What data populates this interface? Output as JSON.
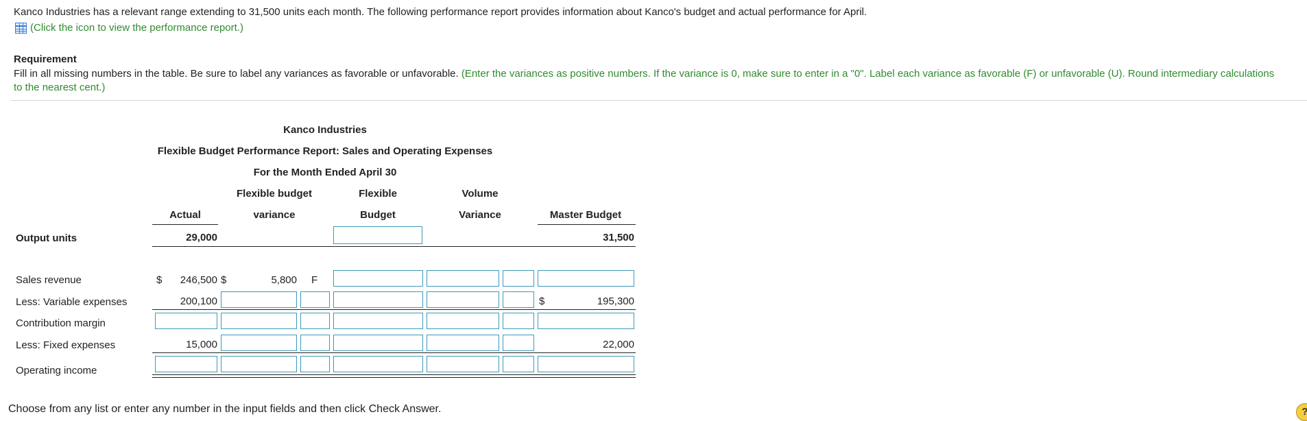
{
  "intro": "Kanco Industries has a relevant range extending to 31,500 units each month. The following performance report provides information about Kanco's budget and actual performance for April.",
  "link_text": "(Click the icon to view the performance report.)",
  "requirement": {
    "title": "Requirement",
    "text": "Fill in all missing numbers in the table. Be sure to label any variances as favorable or unfavorable.",
    "note": "(Enter the variances as positive numbers. If the variance is 0, make sure to enter in a \"0\". Label each variance as favorable (F) or unfavorable (U). Round intermediary calculations to the nearest cent.)"
  },
  "report": {
    "company": "Kanco Industries",
    "title": "Flexible Budget Performance Report: Sales and Operating Expenses",
    "period": "For the Month Ended April 30",
    "headers": {
      "actual": "Actual",
      "fb_variance_1": "Flexible budget",
      "fb_variance_2": "variance",
      "flexible_1": "Flexible",
      "flexible_2": "Budget",
      "volume_1": "Volume",
      "volume_2": "Variance",
      "master": "Master Budget"
    },
    "rows": {
      "output_units": {
        "label": "Output units",
        "actual": "29,000",
        "master": "31,500"
      },
      "sales_revenue": {
        "label": "Sales revenue",
        "dollar": "$",
        "actual": "246,500",
        "fb_dollar": "$",
        "fb_variance": "5,800",
        "fb_label": "F"
      },
      "variable_expenses": {
        "label": "Less: Variable expenses",
        "actual": "200,100",
        "master_dollar": "$",
        "master": "195,300"
      },
      "contribution_margin": {
        "label": "Contribution margin"
      },
      "fixed_expenses": {
        "label": "Less: Fixed expenses",
        "actual": "15,000",
        "master": "22,000"
      },
      "operating_income": {
        "label": "Operating income"
      }
    }
  },
  "footer": "Choose from any list or enter any number in the input fields and then click Check Answer.",
  "help_icon": "?"
}
